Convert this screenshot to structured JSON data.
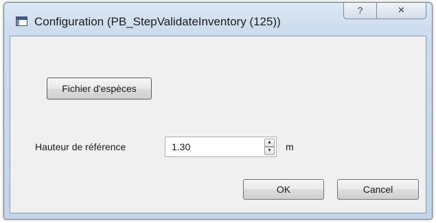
{
  "window": {
    "title": "Configuration (PB_StepValidateInventory (125))",
    "help_glyph": "?",
    "close_glyph": "✕"
  },
  "icons": {
    "app": "window-app-icon",
    "help": "help-icon",
    "close": "close-icon",
    "spin_up": "chevron-up-icon",
    "spin_down": "chevron-down-icon"
  },
  "form": {
    "species_button_label": "Fichier d'espèces",
    "reference_height_label": "Hauteur de référence",
    "reference_height_value": "1.30",
    "unit_label": "m",
    "spin_up_glyph": "▲",
    "spin_down_glyph": "▼"
  },
  "buttons": {
    "ok_label": "OK",
    "cancel_label": "Cancel"
  },
  "colors": {
    "titlebar": "#cddcee",
    "client_background": "#f0f0f0",
    "button_border": "#707070"
  }
}
